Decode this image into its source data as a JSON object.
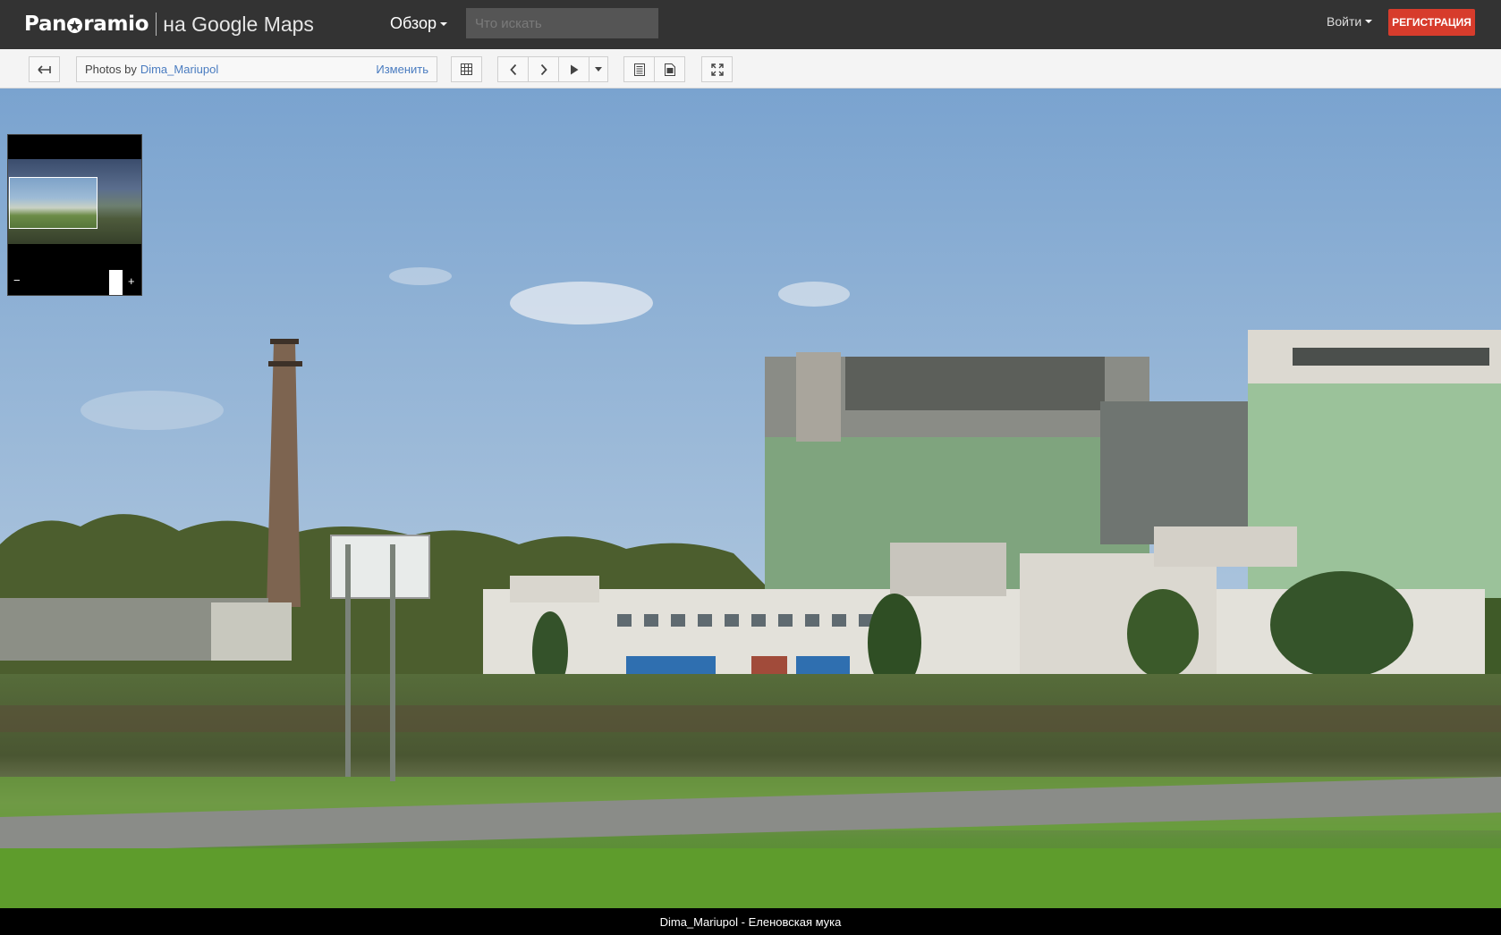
{
  "header": {
    "logo_text_left": "Pan",
    "logo_text_right": "ramio",
    "logo_subtitle": "на Google Maps",
    "browse_label": "Обзор",
    "search_placeholder": "Что искать",
    "login_label": "Войти",
    "signup_label": "РЕГИСТРАЦИЯ"
  },
  "toolbar": {
    "photos_by_prefix": "Photos by",
    "photos_by_user": "Dima_Mariupol",
    "change_label": "Изменить"
  },
  "icons": {
    "back": "back-arrow-icon",
    "grid": "grid-icon",
    "prev": "chevron-left-icon",
    "next": "chevron-right-icon",
    "play": "play-icon",
    "dropdown": "caret-down-icon",
    "info": "info-panel-icon",
    "details": "document-icon",
    "fullscreen": "fullscreen-icon"
  },
  "minimap": {
    "zoom_out_label": "−",
    "zoom_in_label": "+"
  },
  "caption": {
    "text": "Dima_Mariupol - Еленовская мука"
  },
  "colors": {
    "header_bg": "#333333",
    "signup_bg": "#d73c2c",
    "link": "#4a7cc0",
    "toolbar_bg": "#f4f4f4"
  }
}
